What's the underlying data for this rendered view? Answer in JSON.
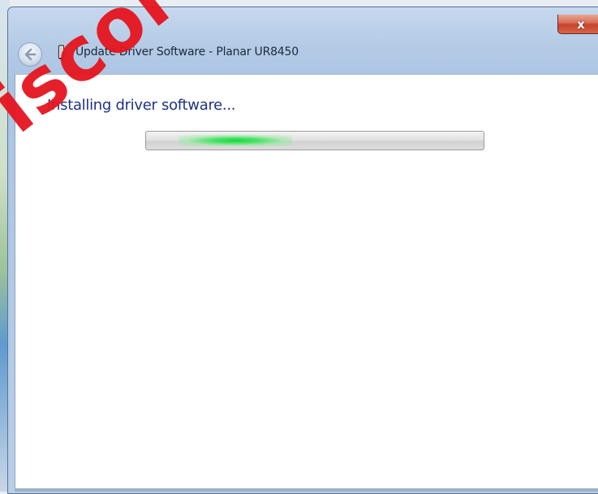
{
  "window": {
    "title": "Update Driver Software - Planar UR8450",
    "close_label": "x"
  },
  "content": {
    "heading": "Installing driver software...",
    "progress": {
      "mode": "indeterminate",
      "glow_color": "#18d43a"
    }
  },
  "icons": {
    "back": "back-arrow-icon",
    "device": "device-icon"
  },
  "watermark": {
    "text": "iscol",
    "color": "#e5151f"
  }
}
